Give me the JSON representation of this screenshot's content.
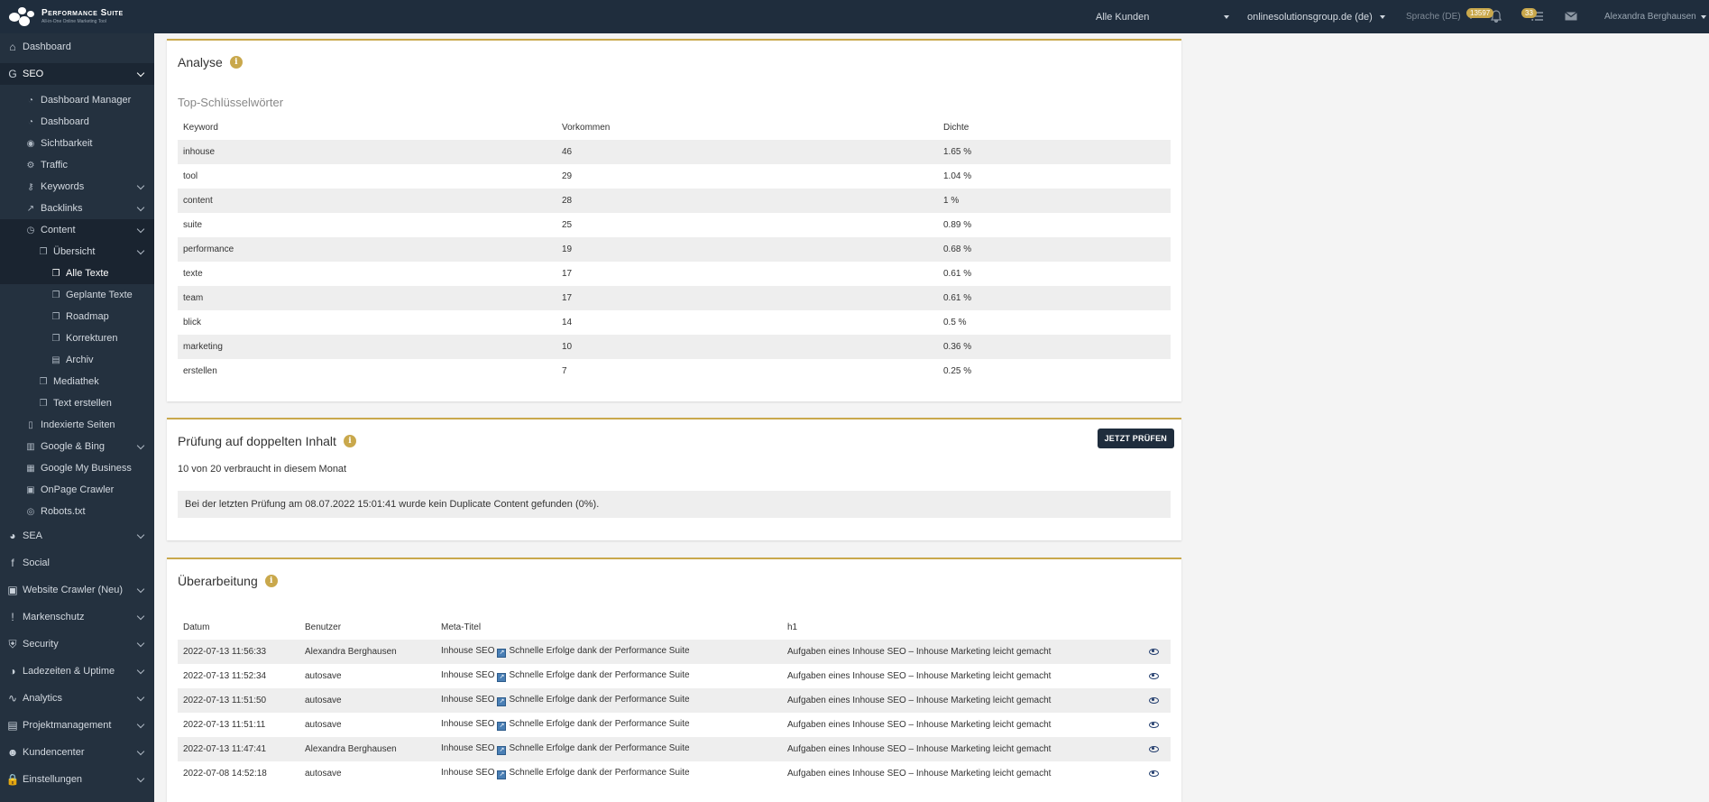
{
  "topbar": {
    "logo_name": "Performance Suite",
    "logo_sub": "All-in-One Online Marketing Tool",
    "customer_select": "Alle Kunden",
    "project_select": "onlinesolutionsgroup.de (de)",
    "language": "Sprache (DE)",
    "notif_count": "13597",
    "tasks_count": "33",
    "user_name": "Alexandra Berghausen"
  },
  "sidebar": {
    "items": [
      {
        "label": "Dashboard",
        "icon": "home-icon"
      },
      {
        "label": "SEO",
        "icon": "google-icon"
      },
      {
        "label": "Dashboard Manager",
        "icon": "dashboard-icon"
      },
      {
        "label": "Dashboard",
        "icon": "dashboard-icon"
      },
      {
        "label": "Sichtbarkeit",
        "icon": "eye-icon"
      },
      {
        "label": "Traffic",
        "icon": "traffic-icon"
      },
      {
        "label": "Keywords",
        "icon": "key-icon"
      },
      {
        "label": "Backlinks",
        "icon": "external-link-icon"
      },
      {
        "label": "Content",
        "icon": "clock-icon"
      },
      {
        "label": "Übersicht",
        "icon": "copy-icon"
      },
      {
        "label": "Alle Texte",
        "icon": "copy-icon"
      },
      {
        "label": "Geplante Texte",
        "icon": "copy-icon"
      },
      {
        "label": "Roadmap",
        "icon": "copy-icon"
      },
      {
        "label": "Korrekturen",
        "icon": "copy-icon"
      },
      {
        "label": "Archiv",
        "icon": "archive-icon"
      },
      {
        "label": "Mediathek",
        "icon": "copy-icon"
      },
      {
        "label": "Text erstellen",
        "icon": "copy-icon"
      },
      {
        "label": "Indexierte Seiten",
        "icon": "file-icon"
      },
      {
        "label": "Google & Bing",
        "icon": "chart-icon"
      },
      {
        "label": "Google My Business",
        "icon": "building-icon"
      },
      {
        "label": "OnPage Crawler",
        "icon": "crawler-icon"
      },
      {
        "label": "Robots.txt",
        "icon": "robot-icon"
      },
      {
        "label": "SEA",
        "icon": "pie-icon"
      },
      {
        "label": "Social",
        "icon": "facebook-icon"
      },
      {
        "label": "Website Crawler (Neu)",
        "icon": "crawler-icon"
      },
      {
        "label": "Markenschutz",
        "icon": "exclamation-icon"
      },
      {
        "label": "Security",
        "icon": "shield-icon"
      },
      {
        "label": "Ladezeiten & Uptime",
        "icon": "gauge-icon"
      },
      {
        "label": "Analytics",
        "icon": "analytics-icon"
      },
      {
        "label": "Projektmanagement",
        "icon": "project-icon"
      },
      {
        "label": "Kundencenter",
        "icon": "users-icon"
      },
      {
        "label": "Einstellungen",
        "icon": "lock-icon"
      }
    ]
  },
  "analyse": {
    "title": "Analyse",
    "subtitle": "Top-Schlüsselwörter",
    "columns": [
      "Keyword",
      "Vorkommen",
      "Dichte"
    ],
    "rows": [
      [
        "inhouse",
        "46",
        "1.65 %"
      ],
      [
        "tool",
        "29",
        "1.04 %"
      ],
      [
        "content",
        "28",
        "1 %"
      ],
      [
        "suite",
        "25",
        "0.89 %"
      ],
      [
        "performance",
        "19",
        "0.68 %"
      ],
      [
        "texte",
        "17",
        "0.61 %"
      ],
      [
        "team",
        "17",
        "0.61 %"
      ],
      [
        "blick",
        "14",
        "0.5 %"
      ],
      [
        "marketing",
        "10",
        "0.36 %"
      ],
      [
        "erstellen",
        "7",
        "0.25 %"
      ]
    ]
  },
  "duplicate": {
    "title": "Prüfung auf doppelten Inhalt",
    "button": "JETZT PRÜFEN",
    "usage": "10 von 20 verbraucht in diesem Monat",
    "result": "Bei der letzten Prüfung am 08.07.2022 15:01:41 wurde kein Duplicate Content gefunden (0%)."
  },
  "revision": {
    "title": "Überarbeitung",
    "columns": [
      "Datum",
      "Benutzer",
      "Meta-Titel",
      "h1"
    ],
    "rows": [
      {
        "date": "2022-07-13 11:56:33",
        "user": "Alexandra Berghausen",
        "meta_a": "Inhouse SEO",
        "meta_b": "Schnelle Erfolge dank der Performance Suite",
        "h1": "Aufgaben eines Inhouse SEO – Inhouse Marketing leicht gemacht"
      },
      {
        "date": "2022-07-13 11:52:34",
        "user": "autosave",
        "meta_a": "Inhouse SEO",
        "meta_b": "Schnelle Erfolge dank der Performance Suite",
        "h1": "Aufgaben eines Inhouse SEO – Inhouse Marketing leicht gemacht"
      },
      {
        "date": "2022-07-13 11:51:50",
        "user": "autosave",
        "meta_a": "Inhouse SEO",
        "meta_b": "Schnelle Erfolge dank der Performance Suite",
        "h1": "Aufgaben eines Inhouse SEO – Inhouse Marketing leicht gemacht"
      },
      {
        "date": "2022-07-13 11:51:11",
        "user": "autosave",
        "meta_a": "Inhouse SEO",
        "meta_b": "Schnelle Erfolge dank der Performance Suite",
        "h1": "Aufgaben eines Inhouse SEO – Inhouse Marketing leicht gemacht"
      },
      {
        "date": "2022-07-13 11:47:41",
        "user": "Alexandra Berghausen",
        "meta_a": "Inhouse SEO",
        "meta_b": "Schnelle Erfolge dank der Performance Suite",
        "h1": "Aufgaben eines Inhouse SEO – Inhouse Marketing leicht gemacht"
      },
      {
        "date": "2022-07-08 14:52:18",
        "user": "autosave",
        "meta_a": "Inhouse SEO",
        "meta_b": "Schnelle Erfolge dank der Performance Suite",
        "h1": "Aufgaben eines Inhouse SEO – Inhouse Marketing leicht gemacht"
      }
    ]
  },
  "colors": {
    "accent": "#c9a84c",
    "topbar": "#1f2d3d",
    "sidebar": "#24313f"
  }
}
